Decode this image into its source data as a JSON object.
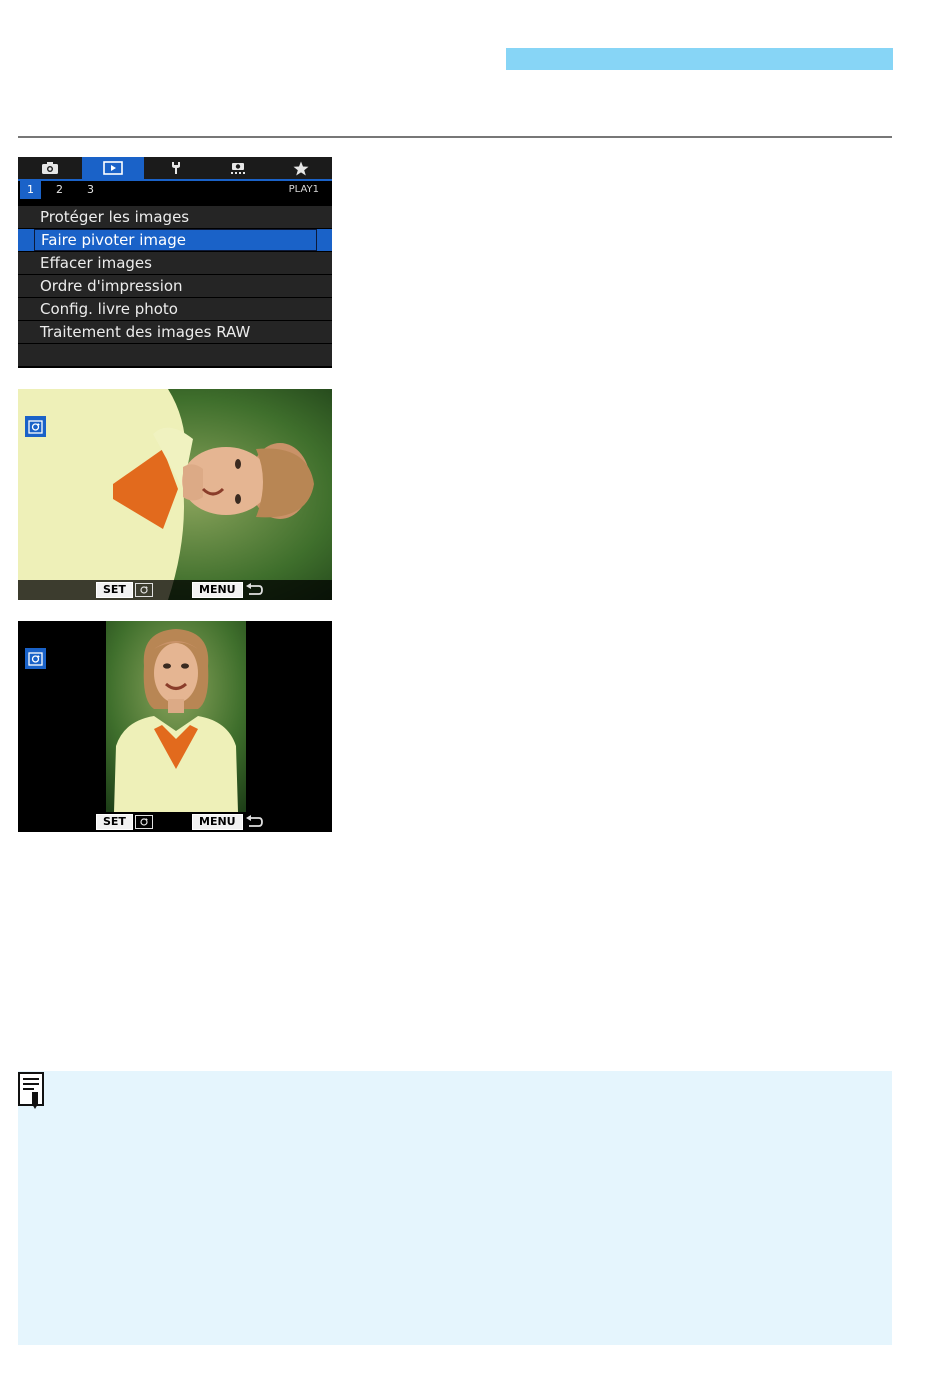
{
  "colors": {
    "header_band": "#87d5f6",
    "accent_blue": "#1a62c8",
    "note_background": "#e5f5fd"
  },
  "menu": {
    "tabs": [
      {
        "icon": "camera-icon"
      },
      {
        "icon": "playback-icon"
      },
      {
        "icon": "wrench-icon"
      },
      {
        "icon": "custom-function-icon"
      },
      {
        "icon": "star-icon"
      }
    ],
    "active_tab": 1,
    "subtabs": [
      "1",
      "2",
      "3"
    ],
    "active_subtab": 0,
    "page_label": "PLAY1",
    "items": [
      "Protéger les images",
      "Faire pivoter image",
      "Effacer images",
      "Ordre d'impression",
      "Config. livre photo",
      "Traitement des images RAW"
    ],
    "selected_item": 1
  },
  "screens": {
    "guide_set_label": "SET",
    "guide_menu_label": "MENU",
    "rotate_icon": "rotate-image-icon",
    "return_icon": "return-arrow-icon"
  },
  "note": {
    "icon": "memo-icon"
  }
}
